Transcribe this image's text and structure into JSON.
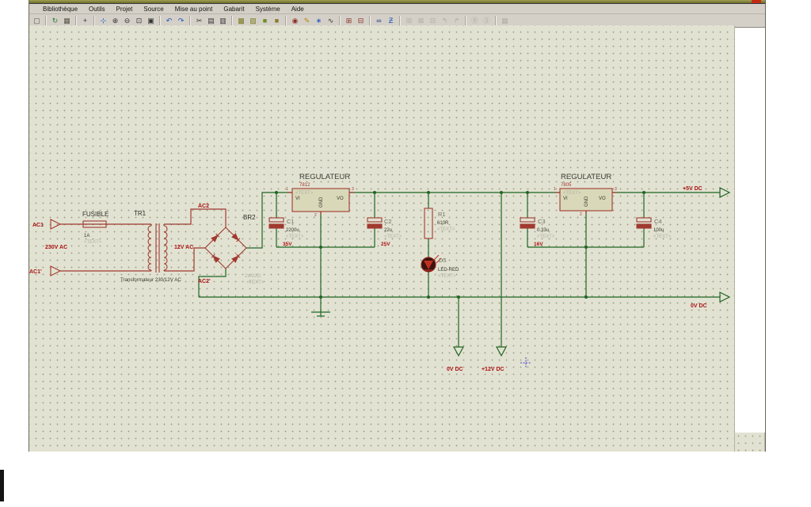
{
  "colors": {
    "wire_green": "#1d6623",
    "component_red": "#a03a30",
    "label_red": "#aa1414",
    "canvas": "#e2e2d2",
    "toolbar_bg": "#d4d0c8",
    "title_strip": "#7a7a30",
    "origin_marker_blue": "#4444cc"
  },
  "menu": {
    "items": [
      "Bibliothèque",
      "Outils",
      "Projet",
      "Source",
      "Mise au point",
      "Gabarit",
      "Système",
      "Aide"
    ]
  },
  "toolbar": {
    "groups": [
      {
        "items": [
          {
            "name": "new-page",
            "glyph": "▢",
            "color": "#555548"
          }
        ]
      },
      {
        "items": [
          {
            "name": "refresh-sheet",
            "glyph": "↻",
            "color": "#2e7d32"
          },
          {
            "name": "toggle-grid",
            "glyph": "▦",
            "color": "#555548"
          }
        ]
      },
      {
        "items": [
          {
            "name": "origin-marker",
            "glyph": "+",
            "color": "#333333"
          }
        ]
      },
      {
        "items": [
          {
            "name": "pan",
            "glyph": "⊹",
            "color": "#1a55bb"
          },
          {
            "name": "zoom-in",
            "glyph": "⊕",
            "color": "#333333"
          },
          {
            "name": "zoom-out",
            "glyph": "⊖",
            "color": "#333333"
          },
          {
            "name": "zoom-area",
            "glyph": "⊡",
            "color": "#333333"
          },
          {
            "name": "zoom-all",
            "glyph": "▣",
            "color": "#333333"
          }
        ]
      },
      {
        "items": [
          {
            "name": "undo",
            "glyph": "↶",
            "color": "#1a55bb"
          },
          {
            "name": "redo",
            "glyph": "↷",
            "color": "#1a55bb"
          }
        ]
      },
      {
        "items": [
          {
            "name": "cut",
            "glyph": "✂",
            "color": "#333333"
          },
          {
            "name": "copy",
            "glyph": "▤",
            "color": "#333333"
          },
          {
            "name": "paste",
            "glyph": "▥",
            "color": "#333333"
          }
        ]
      },
      {
        "items": [
          {
            "name": "block-copy",
            "glyph": "▩",
            "color": "#7a7a1e"
          },
          {
            "name": "block-move",
            "glyph": "▨",
            "color": "#7a7a1e"
          },
          {
            "name": "block-rotate",
            "glyph": "■",
            "color": "#6b8e23"
          },
          {
            "name": "block-delete",
            "glyph": "■",
            "color": "#8a7a2a"
          }
        ]
      },
      {
        "items": [
          {
            "name": "library-pick",
            "glyph": "◉",
            "color": "#8c2f26"
          },
          {
            "name": "packaging-tool",
            "glyph": "✎",
            "color": "#b8860b"
          },
          {
            "name": "decompose",
            "glyph": "∗",
            "color": "#1a55bb"
          },
          {
            "name": "cleanup",
            "glyph": "∿",
            "color": "#333333"
          }
        ]
      },
      {
        "items": [
          {
            "name": "component-mode",
            "glyph": "⊞",
            "color": "#8c2f26"
          },
          {
            "name": "make-device",
            "glyph": "⊟",
            "color": "#8c2f26"
          }
        ]
      },
      {
        "items": [
          {
            "name": "find-component",
            "glyph": "∞",
            "color": "#1a3a8c"
          },
          {
            "name": "property-assignment",
            "glyph": "Ƶ",
            "color": "#1a55bb"
          }
        ]
      },
      {
        "items": [
          {
            "name": "design-explorer",
            "glyph": "⊞",
            "disabled": true
          },
          {
            "name": "remove-sheet",
            "glyph": "⊠",
            "disabled": true
          },
          {
            "name": "merge-sheet",
            "glyph": "⊟",
            "disabled": true
          },
          {
            "name": "goto-parent",
            "glyph": "↰",
            "disabled": true
          },
          {
            "name": "goto-child",
            "glyph": "↱",
            "disabled": true
          }
        ]
      },
      {
        "items": [
          {
            "name": "bill-of-materials",
            "glyph": "Ⓡ",
            "disabled": true
          },
          {
            "name": "electrical-rule-check",
            "glyph": "Ⓢ",
            "disabled": true
          }
        ]
      },
      {
        "items": [
          {
            "name": "netlist-transfer",
            "glyph": "▦",
            "disabled": true
          }
        ]
      }
    ]
  },
  "schematic": {
    "ac1": "AC1",
    "ac1p": "AC1'",
    "v230": "230V AC",
    "v12": "12V AC",
    "ac2": "AC2",
    "ac2p": "AC2'",
    "out5": "+5V DC",
    "out0r": "0V DC",
    "out0b": "0V DC",
    "out12": "+12V DC",
    "fuse": {
      "name": "FUSIBLE",
      "value": "1A",
      "text": "<TEXT>"
    },
    "tr": {
      "ref": "TR1",
      "caption": "Transformateur 230/12V AC"
    },
    "bridge": {
      "ref": "BR2",
      "value": "2W02G",
      "text": "<TEXT>"
    },
    "reg1": {
      "title": "REGULATEUR",
      "part": "7812",
      "text": "<TEXT>",
      "vi": "VI",
      "vo": "VO",
      "gnd": "GND",
      "p1": "1",
      "p2": "2",
      "p3": "3"
    },
    "reg2": {
      "title": "REGULATEUR",
      "part": "7805",
      "text": "<TEXT>",
      "vi": "VI",
      "vo": "VO",
      "gnd": "GND",
      "p1": "1",
      "p2": "2",
      "p3": "3"
    },
    "c1": {
      "ref": "C1",
      "value": "2200u",
      "text": "<TEXT>",
      "volt": "35V"
    },
    "c2": {
      "ref": "C2",
      "value": "22u",
      "text": "<TEXT>",
      "volt": "25V"
    },
    "c3": {
      "ref": "C3",
      "value": "0.33u",
      "text": "<TEXT>",
      "volt": "16V"
    },
    "c4": {
      "ref": "C4",
      "value": "100u",
      "text": "<TEXT>"
    },
    "r1": {
      "ref": "R1",
      "value": "610R",
      "text": "<TEXT>"
    },
    "d5": {
      "ref": "D5",
      "value": "LED-RED",
      "text": "<TEXT>"
    }
  }
}
